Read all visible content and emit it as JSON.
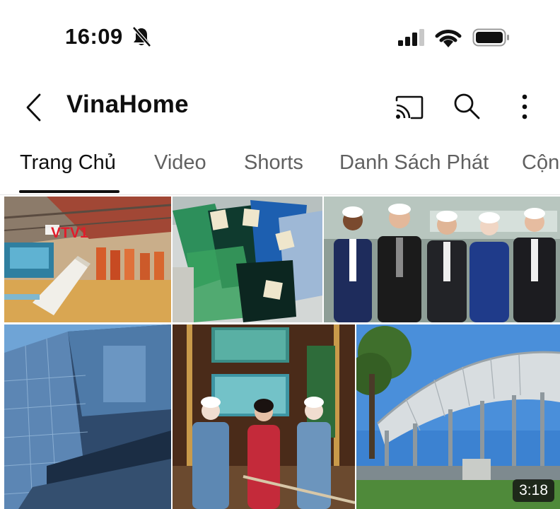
{
  "status_bar": {
    "time": "16:09",
    "icons": [
      "bell-slash-icon",
      "cellular-signal-icon",
      "wifi-icon",
      "battery-icon"
    ]
  },
  "header": {
    "title": "VinaHome",
    "icons": [
      "back-arrow-icon",
      "cast-icon",
      "search-icon",
      "more-vertical-icon"
    ]
  },
  "tabs": [
    {
      "label": "Trang Chủ",
      "active": true
    },
    {
      "label": "Video",
      "active": false
    },
    {
      "label": "Shorts",
      "active": false
    },
    {
      "label": "Danh Sách Phát",
      "active": false
    },
    {
      "label": "Cộng",
      "active": false
    }
  ],
  "grid": {
    "tiles": [
      {
        "logo_text": "VTV1"
      },
      {},
      {},
      {},
      {},
      {
        "duration": "3:18"
      }
    ]
  },
  "colors": {
    "text_primary": "#0f0f0f",
    "text_secondary": "#606060",
    "divider": "#e5e5e5"
  }
}
